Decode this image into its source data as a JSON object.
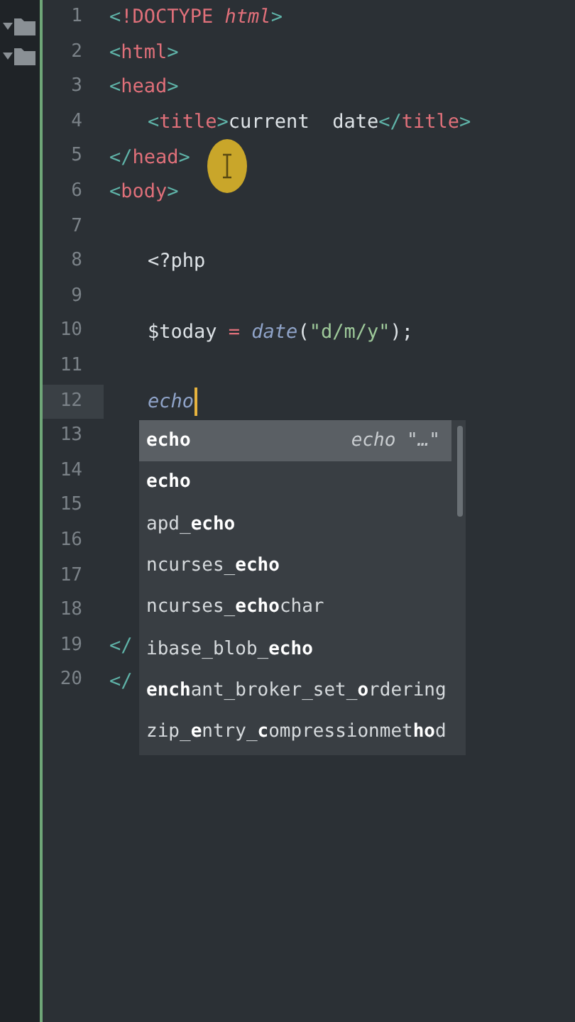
{
  "sidebar": {
    "folders": [
      {
        "expanded": true
      },
      {
        "expanded": true
      }
    ]
  },
  "editor": {
    "lines": [
      {
        "number": "1",
        "current": false,
        "indent": false,
        "tokens": [
          {
            "kind": "punct",
            "text": "<"
          },
          {
            "kind": "tag",
            "text": "!DOCTYPE "
          },
          {
            "kind": "attr",
            "text": "html"
          },
          {
            "kind": "punct",
            "text": ">"
          }
        ]
      },
      {
        "number": "2",
        "current": false,
        "indent": false,
        "tokens": [
          {
            "kind": "punct",
            "text": "<"
          },
          {
            "kind": "tag",
            "text": "html"
          },
          {
            "kind": "punct",
            "text": ">"
          }
        ]
      },
      {
        "number": "3",
        "current": false,
        "indent": false,
        "tokens": [
          {
            "kind": "punct",
            "text": "<"
          },
          {
            "kind": "tag",
            "text": "head"
          },
          {
            "kind": "punct",
            "text": ">"
          }
        ]
      },
      {
        "number": "4",
        "current": false,
        "indent": true,
        "tokens": [
          {
            "kind": "punct",
            "text": "<"
          },
          {
            "kind": "tag",
            "text": "title"
          },
          {
            "kind": "punct",
            "text": ">"
          },
          {
            "kind": "plain",
            "text": "current  date"
          },
          {
            "kind": "punct",
            "text": "</"
          },
          {
            "kind": "tag",
            "text": "title"
          },
          {
            "kind": "punct",
            "text": ">"
          }
        ]
      },
      {
        "number": "5",
        "current": false,
        "indent": false,
        "tokens": [
          {
            "kind": "punct",
            "text": "</"
          },
          {
            "kind": "tag",
            "text": "head"
          },
          {
            "kind": "punct",
            "text": ">"
          }
        ]
      },
      {
        "number": "6",
        "current": false,
        "indent": false,
        "tokens": [
          {
            "kind": "punct",
            "text": "<"
          },
          {
            "kind": "tag",
            "text": "body"
          },
          {
            "kind": "punct",
            "text": ">"
          }
        ]
      },
      {
        "number": "7",
        "current": false
      },
      {
        "number": "8",
        "current": false,
        "indent": true,
        "tokens": [
          {
            "kind": "plain",
            "text": "<?php"
          }
        ]
      },
      {
        "number": "9",
        "current": false
      },
      {
        "number": "10",
        "current": false,
        "indent": true,
        "tokens": [
          {
            "kind": "var",
            "text": "$today"
          },
          {
            "kind": "op",
            "text": " = "
          },
          {
            "kind": "func",
            "text": "date"
          },
          {
            "kind": "plain",
            "text": "("
          },
          {
            "kind": "string",
            "text": "\"d/m/y\""
          },
          {
            "kind": "plain",
            "text": ");"
          }
        ]
      },
      {
        "number": "11",
        "current": false
      },
      {
        "number": "12",
        "current": true,
        "indent": true,
        "tokens": [
          {
            "kind": "func",
            "text": "echo"
          }
        ]
      },
      {
        "number": "13",
        "current": false
      },
      {
        "number": "14",
        "current": false
      },
      {
        "number": "15",
        "current": false
      },
      {
        "number": "16",
        "current": false
      },
      {
        "number": "17",
        "current": false
      },
      {
        "number": "18",
        "current": false
      },
      {
        "number": "19",
        "current": false,
        "indent": false,
        "tokens": [
          {
            "kind": "punct",
            "text": "</"
          }
        ]
      },
      {
        "number": "20",
        "current": false,
        "indent": false,
        "tokens": [
          {
            "kind": "punct",
            "text": "</"
          }
        ]
      }
    ]
  },
  "autocomplete": {
    "items": [
      {
        "label": "**echo**",
        "hint": "echo \"…\"",
        "selected": true
      },
      {
        "label": "**echo**",
        "selected": false
      },
      {
        "label": "apd_**echo**",
        "selected": false
      },
      {
        "label": "ncurses_**echo**",
        "selected": false
      },
      {
        "label": "ncurses_**echo**char",
        "selected": false
      },
      {
        "label": "ibase_blob_**echo**",
        "selected": false
      },
      {
        "label": "**ench**ant_broker_set_**o**rdering",
        "selected": false
      },
      {
        "label": "zip_**e**ntry_**c**ompressionmet**ho**d",
        "selected": false
      }
    ]
  }
}
